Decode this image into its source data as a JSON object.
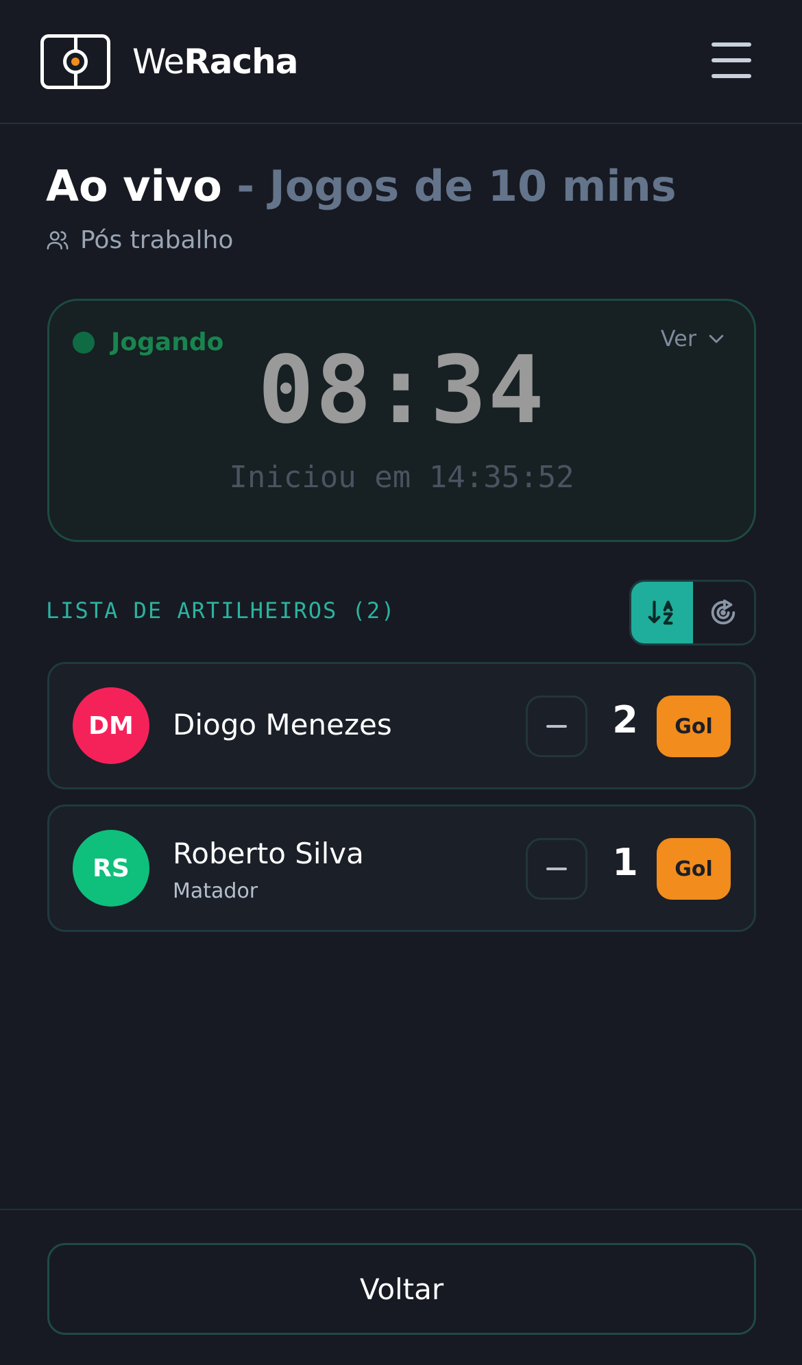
{
  "header": {
    "brand_light": "We",
    "brand_bold": "Racha"
  },
  "page": {
    "title_live": "Ao vivo",
    "title_separator": " - ",
    "title_game": "Jogos de 10 mins",
    "group_name": "Pós trabalho"
  },
  "timer": {
    "status": "Jogando",
    "toggle_label": "Ver",
    "clock": "08:34",
    "started": "Iniciou em 14:35:52"
  },
  "scorers": {
    "title": "LISTA DE ARTILHEIROS (2)",
    "sort_icons": [
      "sort-alpha-icon",
      "goal-target-icon"
    ],
    "players": [
      {
        "initials": "DM",
        "name": "Diogo Menezes",
        "tag": "",
        "goals": "2",
        "avatar_color": "#f5225a",
        "gol_label": "Gol"
      },
      {
        "initials": "RS",
        "name": "Roberto Silva",
        "tag": "Matador",
        "goals": "1",
        "avatar_color": "#0fbf7c",
        "gol_label": "Gol"
      }
    ]
  },
  "footer": {
    "back_label": "Voltar"
  },
  "colors": {
    "accent": "#1fae9b",
    "goal_button": "#f28c1c",
    "status_green": "#18854f"
  }
}
